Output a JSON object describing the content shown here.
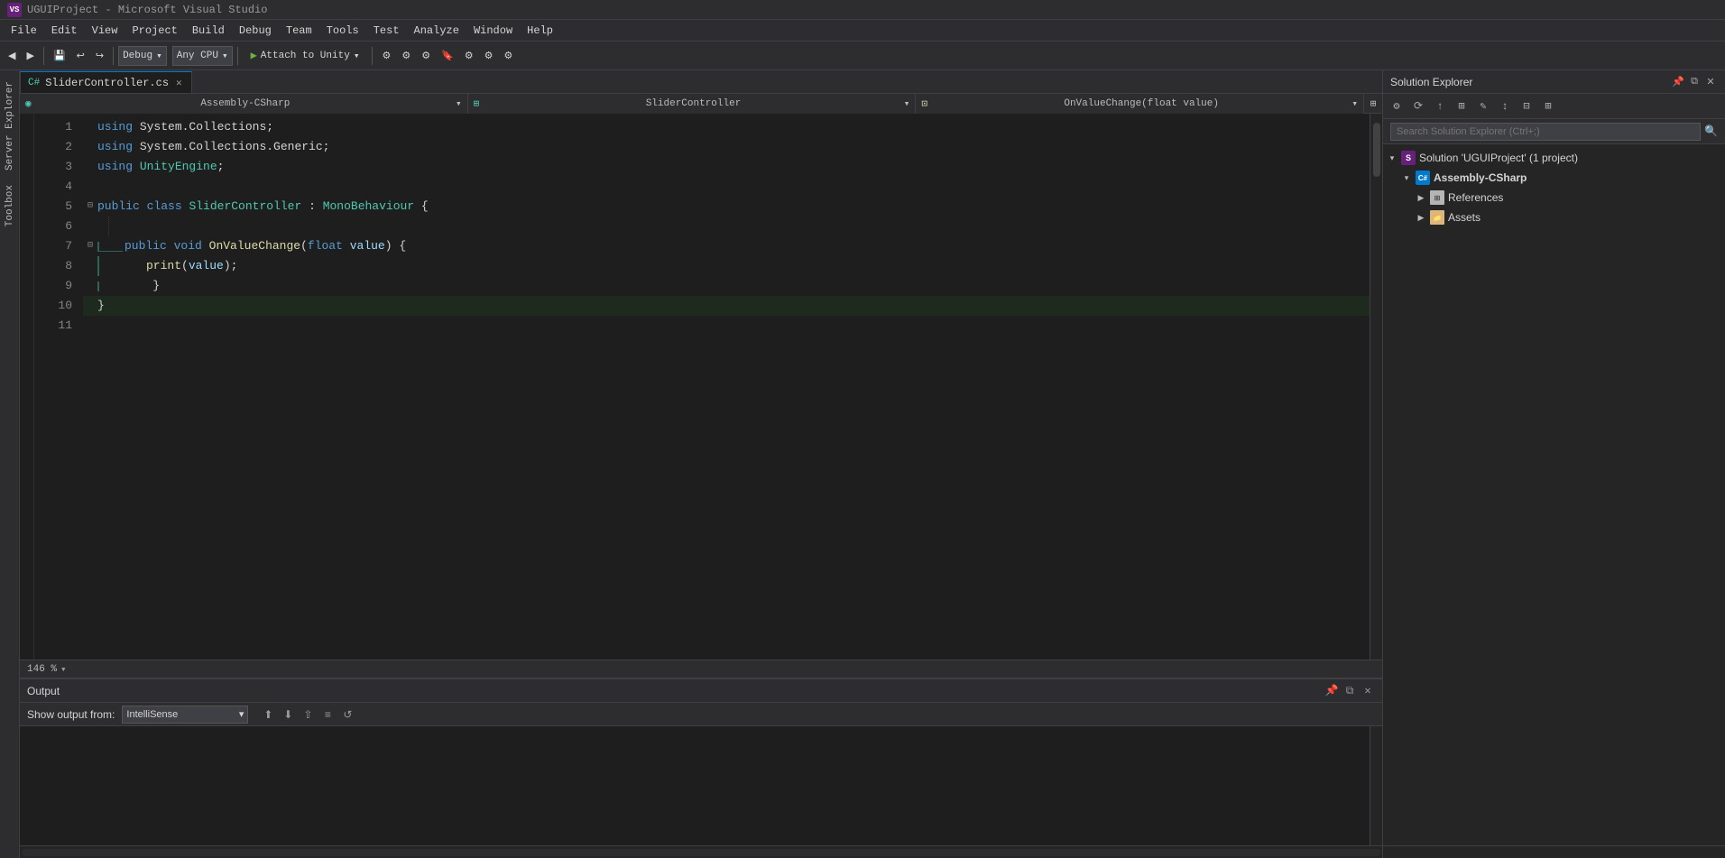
{
  "titleBar": {
    "logo": "VS",
    "title": "UGUIProject - Microsoft Visual Studio"
  },
  "menuBar": {
    "items": [
      "File",
      "Edit",
      "View",
      "Project",
      "Build",
      "Debug",
      "Team",
      "Tools",
      "Test",
      "Analyze",
      "Window",
      "Help"
    ]
  },
  "toolbar": {
    "backBtn": "◀",
    "forwardBtn": "▶",
    "debugMode": "Debug",
    "platform": "Any CPU",
    "attachToUnity": "Attach to Unity",
    "dropdownArrow": "▾"
  },
  "editorTab": {
    "filename": "SliderController.cs",
    "isDirty": false,
    "closeBtn": "✕"
  },
  "navBar": {
    "assembly": "Assembly-CSharp",
    "class": "SliderController",
    "method": "OnValueChange(float value)"
  },
  "codeLines": [
    {
      "num": 1,
      "indent": 0,
      "hasFold": false,
      "content": "using System.Collections;"
    },
    {
      "num": 2,
      "indent": 0,
      "hasFold": false,
      "content": "using System.Collections.Generic;"
    },
    {
      "num": 3,
      "indent": 0,
      "hasFold": false,
      "content": "using UnityEngine;"
    },
    {
      "num": 4,
      "indent": 0,
      "hasFold": false,
      "content": ""
    },
    {
      "num": 5,
      "indent": 0,
      "hasFold": true,
      "content": "public class SliderController : MonoBehaviour {"
    },
    {
      "num": 6,
      "indent": 1,
      "hasFold": false,
      "content": ""
    },
    {
      "num": 7,
      "indent": 1,
      "hasFold": true,
      "content": "    public void OnValueChange(float value) {"
    },
    {
      "num": 8,
      "indent": 2,
      "hasFold": false,
      "content": "        print(value);"
    },
    {
      "num": 9,
      "indent": 2,
      "hasFold": false,
      "content": "    }"
    },
    {
      "num": 10,
      "indent": 0,
      "hasFold": false,
      "content": "}"
    },
    {
      "num": 11,
      "indent": 0,
      "hasFold": false,
      "content": ""
    }
  ],
  "zoomLevel": "146 %",
  "outputPanel": {
    "title": "Output",
    "showFromLabel": "Show output from:",
    "showFromValue": "IntelliSense",
    "pinBtn": "📌",
    "floatBtn": "⧉",
    "closeBtn": "✕"
  },
  "solutionExplorer": {
    "title": "Solution Explorer",
    "searchPlaceholder": "Search Solution Explorer (Ctrl+;)",
    "tree": [
      {
        "level": 1,
        "icon": "solution",
        "label": "Solution 'UGUIProject' (1 project)",
        "expanded": true
      },
      {
        "level": 2,
        "icon": "project",
        "label": "Assembly-CSharp",
        "expanded": true,
        "selected": true
      },
      {
        "level": 3,
        "icon": "refs",
        "label": "References",
        "expanded": false
      },
      {
        "level": 3,
        "icon": "folder",
        "label": "Assets",
        "expanded": false
      }
    ]
  }
}
